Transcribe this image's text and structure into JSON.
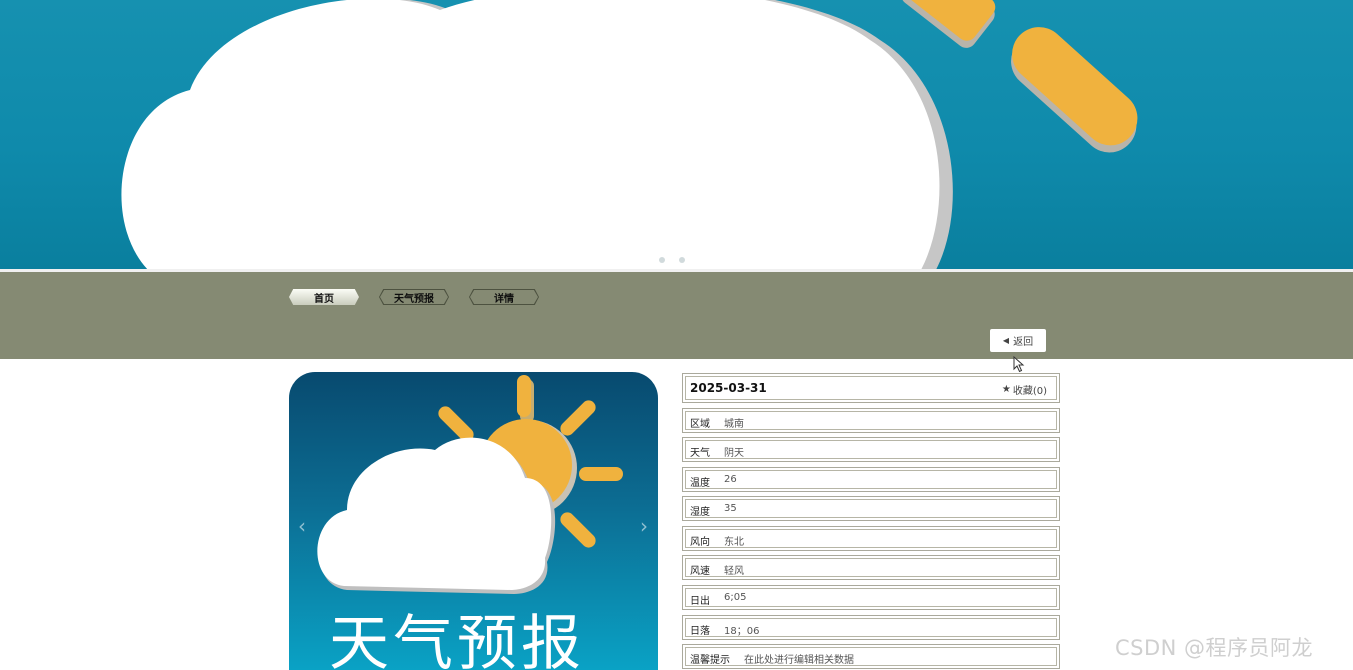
{
  "banner": {
    "dots": [
      "slide-1",
      "slide-2"
    ]
  },
  "nav": {
    "tabs": [
      {
        "label": "首页",
        "active": true
      },
      {
        "label": "天气预报",
        "active": false
      },
      {
        "label": "详情",
        "active": false
      }
    ],
    "back_label": "返回"
  },
  "carousel": {
    "logo_text": "天气预报"
  },
  "detail": {
    "date": "2025-03-31",
    "favorite_label": "收藏(0)",
    "rows": [
      {
        "label": "区域",
        "value": "城南"
      },
      {
        "label": "天气",
        "value": "阴天"
      },
      {
        "label": "温度",
        "value": "26"
      },
      {
        "label": "湿度",
        "value": "35"
      },
      {
        "label": "风向",
        "value": "东北"
      },
      {
        "label": "风速",
        "value": "轻风"
      },
      {
        "label": "日出",
        "value": "6;05"
      },
      {
        "label": "日落",
        "value": "18；06"
      },
      {
        "label": "温馨提示",
        "value": "在此处进行编辑相关数据"
      }
    ]
  },
  "watermark": "CSDN @程序员阿龙",
  "colors": {
    "banner": "#1691b0",
    "nav": "#858a73",
    "sun": "#f0b23e",
    "cloud": "#ffffff"
  }
}
